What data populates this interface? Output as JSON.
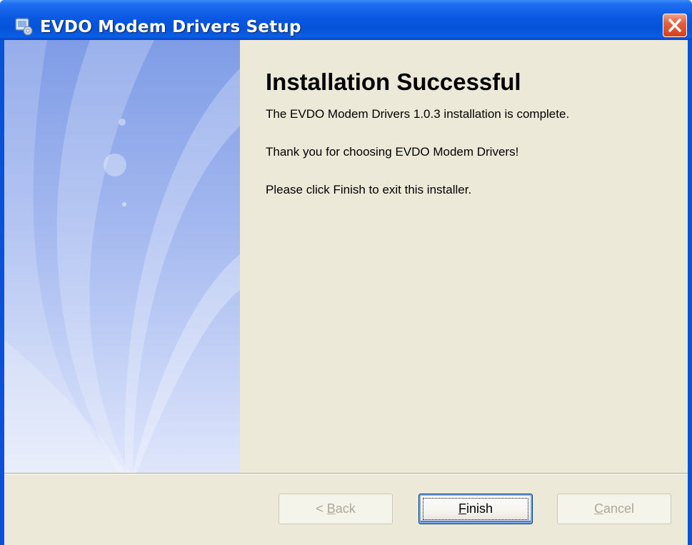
{
  "window": {
    "title": "EVDO Modem Drivers Setup",
    "app_icon": "installer-icon",
    "close_icon": "close-icon"
  },
  "content": {
    "heading": "Installation Successful",
    "line1": "The EVDO Modem Drivers 1.0.3 installation is complete.",
    "line2": "Thank you for choosing EVDO Modem Drivers!",
    "line3": "Please click Finish to exit this installer."
  },
  "buttons": {
    "back": {
      "prefix": "< ",
      "accel": "B",
      "rest": "ack",
      "enabled": false
    },
    "finish": {
      "accel": "F",
      "rest": "inish",
      "enabled": true,
      "default": true
    },
    "cancel": {
      "accel": "C",
      "rest": "ancel",
      "enabled": false
    }
  },
  "colors": {
    "titlebar": "#0453d8",
    "dialog_bg": "#ece9d8",
    "side_panel": "#a8bdf0",
    "close_button": "#d6401f"
  }
}
